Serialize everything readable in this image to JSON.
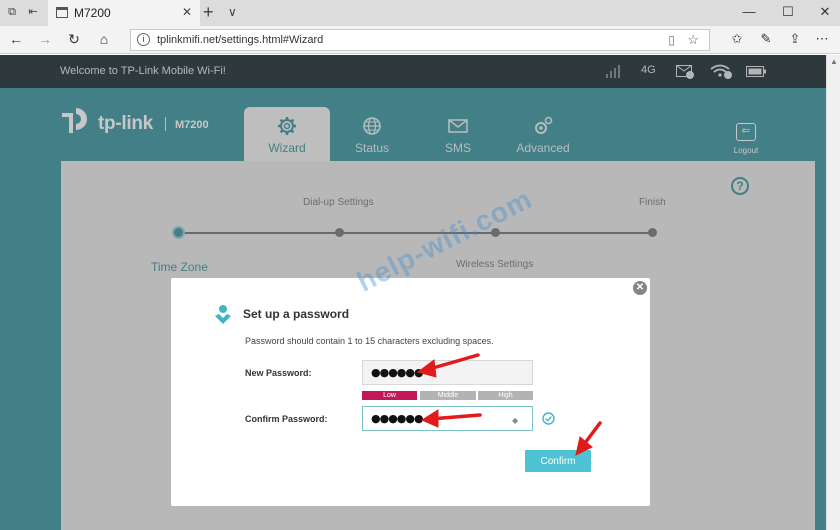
{
  "browser": {
    "tab_title": "M7200",
    "tab_close": "✕",
    "new_tab": "+",
    "tab_menu": "∨",
    "url": "tplinkmifi.net/settings.html#Wizard",
    "win_minimize": "—",
    "win_maximize": "☐",
    "win_close": "✕",
    "back": "←",
    "forward": "→",
    "refresh": "↻",
    "home": "⌂",
    "favorites": "☆"
  },
  "router": {
    "welcome": "Welcome to TP-Link Mobile Wi-Fi!",
    "network_type": "4G",
    "brand": "tp-link",
    "model": "M7200",
    "nav": [
      {
        "label": "Wizard",
        "icon": "gear-icon",
        "active": true
      },
      {
        "label": "Status",
        "icon": "globe-icon",
        "active": false
      },
      {
        "label": "SMS",
        "icon": "envelope-icon",
        "active": false
      },
      {
        "label": "Advanced",
        "icon": "gears-icon",
        "active": false
      }
    ],
    "logout": "Logout",
    "help": "?"
  },
  "wizard": {
    "steps": [
      "Time Zone",
      "Dial-up Settings",
      "Wireless Settings",
      "Finish"
    ],
    "active_step": 0
  },
  "watermark": "help-wifi.com",
  "modal": {
    "title": "Set up a password",
    "description": "Password should contain 1 to 15 characters excluding spaces.",
    "new_password_label": "New Password:",
    "new_password_value": "●●●●●●",
    "strength": [
      "Low",
      "Middle",
      "High"
    ],
    "strength_level": "Low",
    "confirm_password_label": "Confirm Password:",
    "confirm_password_value": "●●●●●●",
    "confirm_button": "Confirm"
  },
  "colors": {
    "accent": "#56a3ad",
    "top_strip": "#3c4a4f",
    "strength_low": "#c2185b",
    "strength_inactive": "#b3b3b3",
    "button": "#4ec2d3",
    "arrows": "#e11a1a"
  }
}
